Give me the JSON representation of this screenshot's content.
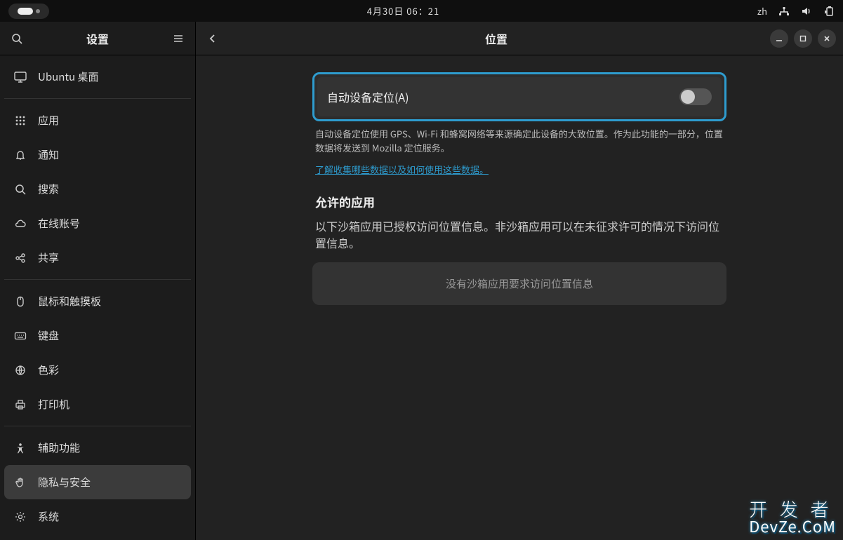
{
  "topbar": {
    "datetime": "4月30日  06：21",
    "input_method": "zh"
  },
  "sidebar": {
    "title": "设置",
    "items": [
      {
        "label": "Ubuntu 桌面",
        "icon": "monitor-icon"
      },
      {
        "sep": true
      },
      {
        "label": "应用",
        "icon": "grid-icon"
      },
      {
        "label": "通知",
        "icon": "bell-icon"
      },
      {
        "label": "搜索",
        "icon": "search-icon"
      },
      {
        "label": "在线账号",
        "icon": "cloud-icon"
      },
      {
        "label": "共享",
        "icon": "share-icon"
      },
      {
        "sep": true
      },
      {
        "label": "鼠标和触摸板",
        "icon": "mouse-icon"
      },
      {
        "label": "键盘",
        "icon": "keyboard-icon"
      },
      {
        "label": "色彩",
        "icon": "globe-icon"
      },
      {
        "label": "打印机",
        "icon": "printer-icon"
      },
      {
        "sep": true
      },
      {
        "label": "辅助功能",
        "icon": "accessibility-icon"
      },
      {
        "label": "隐私与安全",
        "icon": "hand-icon",
        "selected": true
      },
      {
        "label": "系统",
        "icon": "gear-icon"
      }
    ]
  },
  "content": {
    "title": "位置",
    "toggle_label": "自动设备定位(A)",
    "toggle_on": false,
    "description": "自动设备定位使用 GPS、Wi-Fi 和蜂窝网络等来源确定此设备的大致位置。作为此功能的一部分，位置数据将发送到 Mozilla 定位服务。",
    "link": "了解收集哪些数据以及如何使用这些数据。",
    "section_title": "允许的应用",
    "section_subtitle": "以下沙箱应用已授权访问位置信息。非沙箱应用可以在未征求许可的情况下访问位置信息。",
    "empty": "没有沙箱应用要求访问位置信息"
  },
  "watermark": {
    "line1": "开 发 者",
    "line2": "DevZe.CoM"
  }
}
